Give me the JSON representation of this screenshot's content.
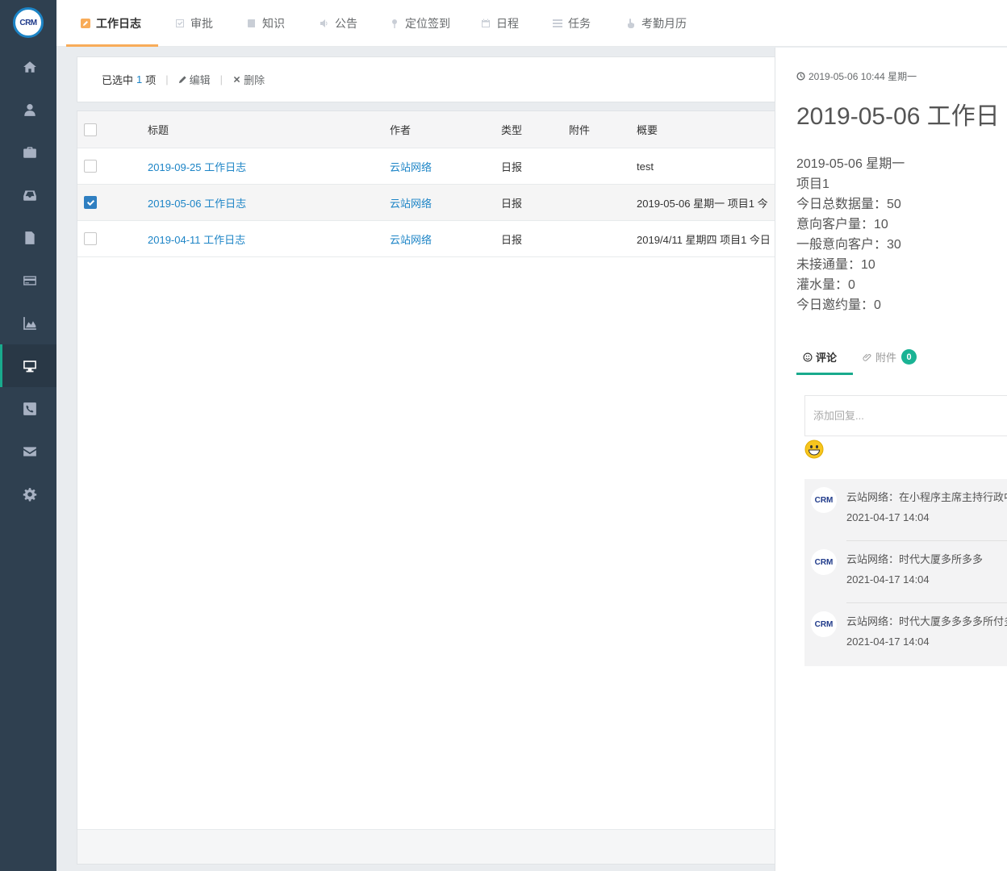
{
  "logo": {
    "text": "CRM"
  },
  "sidebar": {
    "items": [
      {
        "name": "home-icon",
        "active": false
      },
      {
        "name": "user-icon",
        "active": false
      },
      {
        "name": "briefcase-icon",
        "active": false
      },
      {
        "name": "inbox-icon",
        "active": false
      },
      {
        "name": "document-icon",
        "active": false
      },
      {
        "name": "credit-card-icon",
        "active": false
      },
      {
        "name": "area-chart-icon",
        "active": false
      },
      {
        "name": "desktop-icon",
        "active": true
      },
      {
        "name": "phone-icon",
        "active": false
      },
      {
        "name": "envelope-icon",
        "active": false
      },
      {
        "name": "gear-icon",
        "active": false
      }
    ]
  },
  "tabs": [
    {
      "label": "工作日志",
      "icon": "edit-icon",
      "active": true
    },
    {
      "label": "审批",
      "icon": "check-square-icon"
    },
    {
      "label": "知识",
      "icon": "book-icon"
    },
    {
      "label": "公告",
      "icon": "volume-icon"
    },
    {
      "label": "定位签到",
      "icon": "map-pin-icon"
    },
    {
      "label": "日程",
      "icon": "calendar-icon"
    },
    {
      "label": "任务",
      "icon": "list-icon"
    },
    {
      "label": "考勤月历",
      "icon": "hand-pointer-icon"
    }
  ],
  "toolbar": {
    "selected_prefix": "已选中",
    "selected_count": "1",
    "selected_suffix": "项",
    "separator": "|",
    "edit_label": "编辑",
    "delete_label": "删除"
  },
  "table": {
    "columns": [
      "标题",
      "作者",
      "类型",
      "附件",
      "概要"
    ],
    "rows": [
      {
        "title": "2019-09-25 工作日志",
        "author": "云站网络",
        "type": "日报",
        "attachment": "",
        "summary": "test",
        "checked": false
      },
      {
        "title": "2019-05-06 工作日志",
        "author": "云站网络",
        "type": "日报",
        "attachment": "",
        "summary": "2019-05-06 星期一 项目1 今",
        "checked": true
      },
      {
        "title": "2019-04-11 工作日志",
        "author": "云站网络",
        "type": "日报",
        "attachment": "",
        "summary": "2019/4/11 星期四 项目1 今日",
        "checked": false
      }
    ]
  },
  "detail": {
    "datetime": "2019-05-06 10:44 星期一",
    "title": "2019-05-06 工作日",
    "lines": [
      "2019-05-06 星期一",
      "项目1",
      "今日总数据量：50",
      "意向客户量：10",
      "一般意向客户：30",
      "未接通量：10",
      "灌水量：0",
      "今日邀约量：0"
    ],
    "tab_comments": "评论",
    "tab_attachments": "附件",
    "attachment_count": "0",
    "reply_placeholder": "添加回复...",
    "comments": [
      {
        "avatar": "CRM",
        "text": "云站网络：在小程序主席主持行政中",
        "date": "2021-04-17 14:04"
      },
      {
        "avatar": "CRM",
        "text": "云站网络：时代大厦多所多多",
        "date": "2021-04-17 14:04"
      },
      {
        "avatar": "CRM",
        "text": "云站网络：时代大厦多多多多所付多",
        "date": "2021-04-17 14:04"
      }
    ]
  },
  "colors": {
    "sidebar_bg": "#2f4050",
    "accent_orange": "#f8ac59",
    "accent_green": "#1ab394",
    "link_blue": "#1c84c6",
    "checkbox_blue": "#2f7fc1"
  }
}
